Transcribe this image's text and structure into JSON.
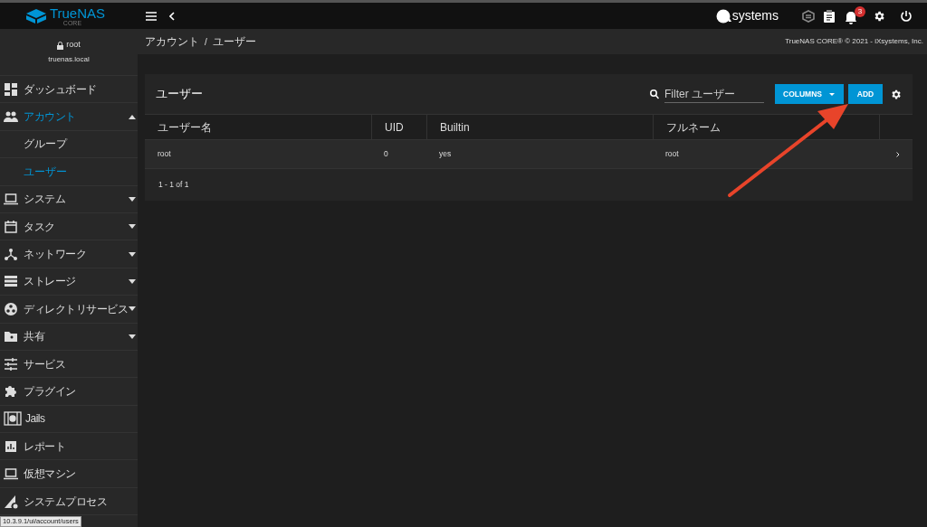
{
  "brand": {
    "name": "TrueNAS",
    "edition": "CORE"
  },
  "topbar": {
    "vendor": "systems",
    "notification_count": "3"
  },
  "user": {
    "name": "root",
    "host": "truenas.local"
  },
  "sidebar": {
    "items": [
      {
        "label": "ダッシュボード",
        "expandable": false,
        "selected": false
      },
      {
        "label": "アカウント",
        "expandable": true,
        "expanded": true,
        "selected": true,
        "children": [
          {
            "label": "グループ",
            "selected": false
          },
          {
            "label": "ユーザー",
            "selected": true
          }
        ]
      },
      {
        "label": "システム",
        "expandable": true,
        "expanded": false,
        "selected": false
      },
      {
        "label": "タスク",
        "expandable": true,
        "expanded": false,
        "selected": false
      },
      {
        "label": "ネットワーク",
        "expandable": true,
        "expanded": false,
        "selected": false
      },
      {
        "label": "ストレージ",
        "expandable": true,
        "expanded": false,
        "selected": false
      },
      {
        "label": "ディレクトリサービス",
        "expandable": true,
        "expanded": false,
        "selected": false
      },
      {
        "label": "共有",
        "expandable": true,
        "expanded": false,
        "selected": false
      },
      {
        "label": "サービス",
        "expandable": false,
        "selected": false
      },
      {
        "label": "プラグイン",
        "expandable": false,
        "selected": false
      },
      {
        "label": "Jails",
        "expandable": false,
        "selected": false
      },
      {
        "label": "レポート",
        "expandable": false,
        "selected": false
      },
      {
        "label": "仮想マシン",
        "expandable": false,
        "selected": false
      },
      {
        "label": "システムプロセス",
        "expandable": false,
        "selected": false
      }
    ]
  },
  "breadcrumb": {
    "items": [
      "アカウント",
      "ユーザー"
    ],
    "separator": "/"
  },
  "copyright": "TrueNAS CORE® © 2021 - iXsystems, Inc.",
  "card": {
    "title": "ユーザー",
    "filter": {
      "placeholder": "Filter ユーザー"
    },
    "columns_button": "COLUMNS",
    "add_button": "ADD",
    "table": {
      "columns": [
        "ユーザー名",
        "UID",
        "Builtin",
        "フルネーム"
      ],
      "rows": [
        [
          "root",
          "0",
          "yes",
          "root"
        ]
      ]
    },
    "pagination": "1 - 1 of 1"
  },
  "status_url": "10.3.9.1/ui/account/users"
}
